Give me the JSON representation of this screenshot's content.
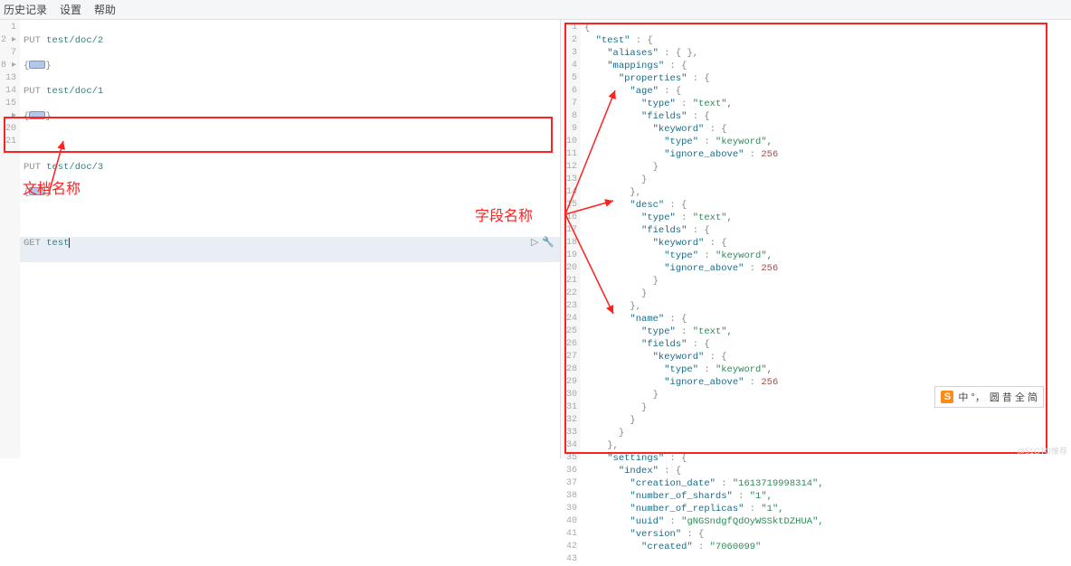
{
  "menubar": {
    "history": "历史记录",
    "settings": "设置",
    "help": "帮助"
  },
  "annotations": {
    "doc_name": "文档名称",
    "field_name": "字段名称"
  },
  "ime": {
    "s": "S",
    "text": "中 °，",
    "extra": "圆 昔 全 简"
  },
  "watermark": "@51CTO推荐",
  "left": {
    "line1": {
      "num": "1",
      "method": "PUT",
      "path": "test/doc/2"
    },
    "line2": {
      "num": "2",
      "brace": "{",
      "close": "}"
    },
    "line3": {
      "num": "7",
      "method": "PUT",
      "path": "test/doc/1"
    },
    "line4": {
      "num": "8",
      "brace": "{",
      "close": "}"
    },
    "line5": {
      "num": "13"
    },
    "line6": {
      "num": "14",
      "method": "PUT",
      "path": "test/doc/3"
    },
    "line7": {
      "num": "15",
      "brace": "{",
      "close": "}"
    },
    "line8": {
      "num": "20"
    },
    "line9": {
      "num": "21",
      "method": "GET",
      "path": "test"
    },
    "run_icon": "▷",
    "wrench_icon": "🔧"
  },
  "right": {
    "gutter": [
      "1",
      "2",
      "3",
      "4",
      "5",
      "6",
      "7",
      "8",
      "9",
      "10",
      "11",
      "12",
      "13",
      "14",
      "15",
      "16",
      "17",
      "18",
      "19",
      "20",
      "21",
      "22",
      "23",
      "24",
      "25",
      "26",
      "27",
      "28",
      "29",
      "30",
      "31",
      "32",
      "33",
      "34",
      "35",
      "36",
      "37",
      "38",
      "39",
      "40",
      "41",
      "42",
      "43"
    ],
    "json": {
      "root_open": "{",
      "test": "\"test\"",
      "aliases": "\"aliases\"",
      "aliases_v": "{ },",
      "mappings": "\"mappings\"",
      "open": "{",
      "close": "}",
      "closec": "},",
      "properties": "\"properties\"",
      "age": "\"age\"",
      "desc": "\"desc\"",
      "name": "\"name\"",
      "type": "\"type\"",
      "text": "\"text\",",
      "fields": "\"fields\"",
      "keyword": "\"keyword\"",
      "keyword_v": "\"keyword\",",
      "ignore_above": "\"ignore_above\"",
      "ignore_v": "256",
      "settings": "\"settings\"",
      "index": "\"index\"",
      "creation_date": "\"creation_date\"",
      "creation_v": "\"1613719998314\",",
      "shards": "\"number_of_shards\"",
      "shards_v": "\"1\",",
      "replicas": "\"number_of_replicas\"",
      "replicas_v": "\"1\",",
      "uuid": "\"uuid\"",
      "uuid_v": "\"gNGSndgfQdOyWSSktDZHUA\",",
      "version": "\"version\"",
      "created": "\"created\"",
      "created_v": "\"7060099\""
    }
  }
}
